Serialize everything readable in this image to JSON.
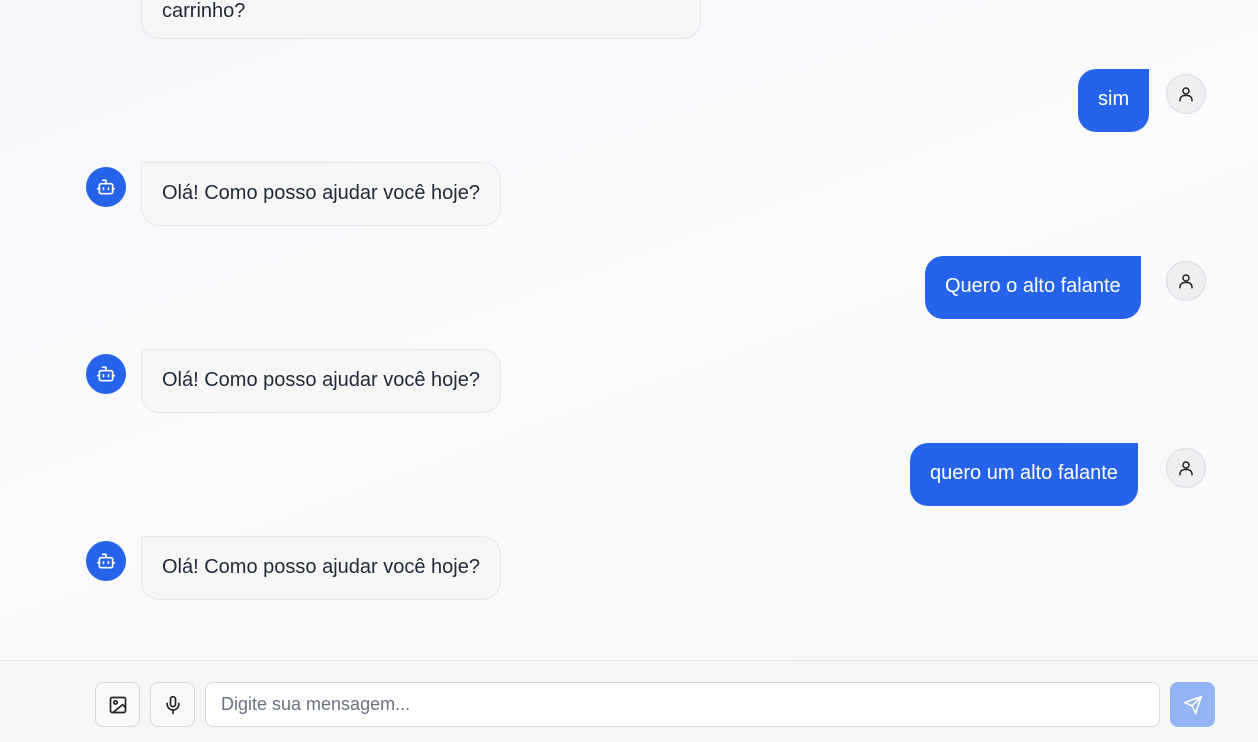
{
  "messages": [
    {
      "role": "bot",
      "text": "carrinho?"
    },
    {
      "role": "user",
      "text": "sim"
    },
    {
      "role": "bot",
      "text": "Olá! Como posso ajudar você hoje?"
    },
    {
      "role": "user",
      "text": "Quero o alto falante"
    },
    {
      "role": "bot",
      "text": "Olá! Como posso ajudar você hoje?"
    },
    {
      "role": "user",
      "text": "quero um alto falante"
    },
    {
      "role": "bot",
      "text": "Olá! Como posso ajudar você hoje?"
    }
  ],
  "icons": {
    "bot_avatar": "bot-icon",
    "user_avatar": "user-icon",
    "image_button": "image-icon",
    "mic_button": "microphone-icon",
    "send_button": "send-icon"
  },
  "composer": {
    "placeholder": "Digite sua mensagem...",
    "value": ""
  },
  "colors": {
    "accent": "#2563eb",
    "send_disabled": "#93b4f5",
    "bot_bubble": "#f7f7f8"
  }
}
